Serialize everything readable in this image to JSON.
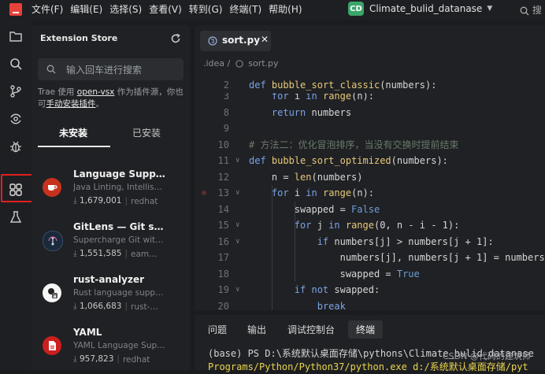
{
  "menu": [
    "文件(F)",
    "编辑(E)",
    "选择(S)",
    "查看(V)",
    "转到(G)",
    "终端(T)",
    "帮助(H)"
  ],
  "project": {
    "badge": "CD",
    "name": "Climate_bulid_datanase"
  },
  "top_search_placeholder": "搜",
  "extensions": {
    "title": "Extension Store",
    "search_placeholder": "输入回车进行搜索",
    "info_prefix": "Trae 使用 ",
    "info_link": "open-vsx",
    "info_mid": " 作为插件源，你也可",
    "info_link2": "手动安装插件",
    "info_suffix": "。",
    "tab_not_installed": "未安装",
    "tab_installed": "已安装",
    "items": [
      {
        "name": "Language Support for Java",
        "desc": "Java Linting, Intellisense, formatting",
        "downloads": "1,679,001",
        "publisher": "redhat"
      },
      {
        "name": "GitLens — Git supercharged",
        "desc": "Supercharge Git within VS Code",
        "downloads": "1,551,585",
        "publisher": "eamodio"
      },
      {
        "name": "rust-analyzer",
        "desc": "Rust language support for Visual Studio Code",
        "downloads": "1,066,683",
        "publisher": "rust-lang"
      },
      {
        "name": "YAML",
        "desc": "YAML Language Support by Red Hat",
        "downloads": "957,823",
        "publisher": "redhat"
      }
    ]
  },
  "editor": {
    "tab_name": "sort.py",
    "breadcrumb_folder": ".idea",
    "breadcrumb_sep": "/",
    "breadcrumb_file": "sort.py",
    "sticky_ln": "2",
    "lines": [
      {
        "n": "3",
        "html": "<span class='tx'>    </span><span class='kw'>for</span><span class='tx'> i </span><span class='kw'>in</span><span class='tx'> </span><span class='fn'>range</span><span class='tx'>(n):</span>"
      },
      {
        "n": "8",
        "html": "<span class='tx'>    </span><span class='kw'>return</span><span class='tx'> numbers</span>"
      },
      {
        "n": "9",
        "html": ""
      },
      {
        "n": "10",
        "html": "<span class='cm'># 方法二：优化冒泡排序，当没有交换时提前结束</span>"
      },
      {
        "n": "11",
        "html": "<span class='kw'>def</span><span class='tx'> </span><span class='fn'>bubble_sort_optimized</span><span class='tx'>(numbers):</span>"
      },
      {
        "n": "12",
        "html": "<span class='tx'>    n = </span><span class='fn'>len</span><span class='tx'>(numbers)</span>"
      },
      {
        "n": "13",
        "html": "<span class='tx'>    </span><span class='kw'>for</span><span class='tx'> i </span><span class='kw'>in</span><span class='tx'> </span><span class='fn'>range</span><span class='tx'>(n):</span>"
      },
      {
        "n": "14",
        "html": "<span class='tx'>        swapped = </span><span class='st'>False</span>"
      },
      {
        "n": "15",
        "html": "<span class='tx'>        </span><span class='kw'>for</span><span class='tx'> j </span><span class='kw'>in</span><span class='tx'> </span><span class='fn'>range</span><span class='tx'>(0, n - i - 1):</span>"
      },
      {
        "n": "16",
        "html": "<span class='tx'>            </span><span class='kw'>if</span><span class='tx'> numbers[j] &gt; numbers[j + 1]:</span>"
      },
      {
        "n": "17",
        "html": "<span class='tx'>                numbers[j], numbers[j + 1] = numbers</span>"
      },
      {
        "n": "18",
        "html": "<span class='tx'>                swapped = </span><span class='st'>True</span>"
      },
      {
        "n": "19",
        "html": "<span class='tx'>        </span><span class='kw'>if</span><span class='tx'> </span><span class='kw'>not</span><span class='tx'> swapped:</span>"
      },
      {
        "n": "20",
        "html": "<span class='tx'>            </span><span class='kw'>break</span>"
      }
    ],
    "sticky_code": "<span class='kw'>def</span><span class='tx'> </span><span class='fn'>bubble_sort_classic</span><span class='tx'>(numbers):</span>"
  },
  "panel": {
    "tabs": [
      "问题",
      "输出",
      "调试控制台",
      "终端"
    ],
    "active_tab": "终端",
    "term_line1": "(base) PS D:\\系统默认桌面存储\\pythons\\Climate_bulid_datanase",
    "term_line2": "Programs/Python/Python37/python.exe d:/系统默认桌面存储/pyt"
  },
  "watermark": "CSDN @代码的建筑师",
  "colors": {
    "accent_red": "#e02020",
    "keyword": "#7aa2e8",
    "function": "#e8c97a",
    "comment": "#6a7a6a",
    "constant": "#6b9fd6",
    "terminal_yellow": "#e8d44d"
  }
}
